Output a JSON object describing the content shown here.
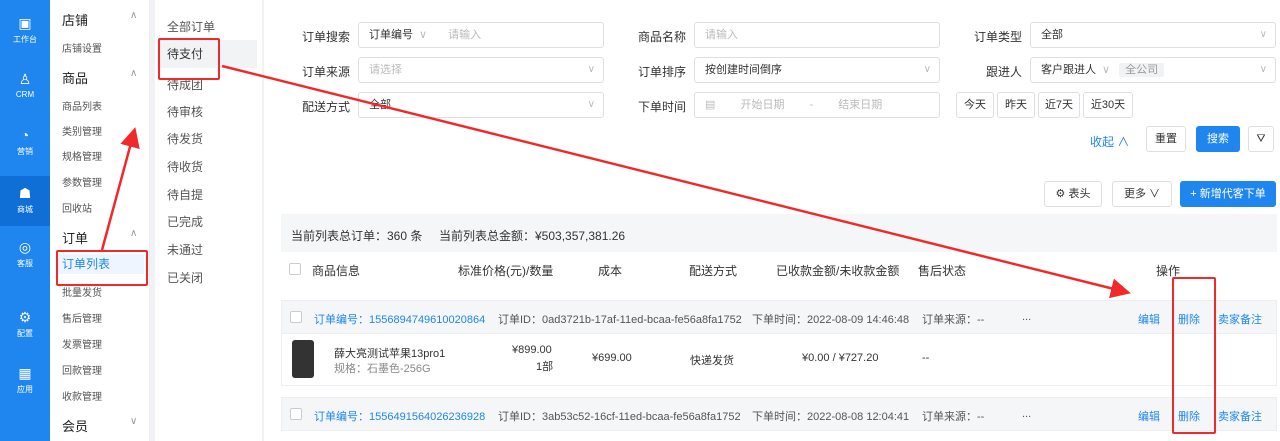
{
  "rail": [
    {
      "label": "工作台",
      "icon": "workbench-icon",
      "glyph": "▣"
    },
    {
      "label": "CRM",
      "icon": "user-icon",
      "glyph": "♙"
    },
    {
      "label": "营销",
      "icon": "marketing-icon",
      "glyph": "◔"
    },
    {
      "label": "商城",
      "icon": "shop-icon",
      "glyph": "☗"
    },
    {
      "label": "客服",
      "icon": "chat-icon",
      "glyph": "◎"
    },
    {
      "label": "配置",
      "icon": "gear-icon",
      "glyph": "⚙"
    },
    {
      "label": "应用",
      "icon": "apps-icon",
      "glyph": "▦"
    }
  ],
  "menu": {
    "groups": [
      "店铺",
      "商品",
      "订单",
      "会员"
    ],
    "items": [
      "店铺设置",
      "商品列表",
      "类别管理",
      "规格管理",
      "参数管理",
      "回收站",
      "订单列表",
      "批量发货",
      "售后管理",
      "发票管理",
      "回款管理",
      "收款管理"
    ]
  },
  "status_tabs": [
    "全部订单",
    "待支付",
    "待成团",
    "待审核",
    "待发货",
    "待收货",
    "待自提",
    "已完成",
    "未通过",
    "已关闭"
  ],
  "filters": {
    "search_label": "订单搜索",
    "search_type": "订单编号",
    "search_ph": "请输入",
    "goods_label": "商品名称",
    "goods_ph": "请输入",
    "type_label": "订单类型",
    "type_val": "全部",
    "source_label": "订单来源",
    "source_ph": "请选择",
    "sort_label": "订单排序",
    "sort_val": "按创建时间倒序",
    "follow_label": "跟进人",
    "follow_val": "客户跟进人",
    "company": "全公司",
    "ship_label": "配送方式",
    "ship_val": "全部",
    "time_label": "下单时间",
    "start_ph": "开始日期",
    "dash": "-",
    "end_ph": "结束日期",
    "quick": [
      "今天",
      "昨天",
      "近7天",
      "近30天"
    ],
    "collapse": "收起 ∧",
    "reset": "重置",
    "search_btn": "搜索"
  },
  "toolbar": {
    "header_btn": "表头",
    "more_btn": "更多",
    "add_btn": "+ 新增代客下单"
  },
  "summary": {
    "total": "当前列表总订单：360 条",
    "amount": "当前列表总金额：¥503,357,381.26"
  },
  "columns": [
    "商品信息",
    "标准价格(元)/数量",
    "成本",
    "配送方式",
    "已收款金额/未收款金额",
    "售后状态",
    "操作"
  ],
  "orders": [
    {
      "no": "订单编号：1556894749610020864",
      "id": "订单ID：0ad3721b-17af-11ed-bcaa-fe56a8fa1752",
      "time": "下单时间：2022-08-09 14:46:48",
      "source": "订单来源：--",
      "dots": "...",
      "actions": [
        "编辑",
        "删除",
        "卖家备注"
      ],
      "product": "薛大亮测试苹果13pro1",
      "spec": "规格：石墨色-256G",
      "price": "¥899.00",
      "qty": "1部",
      "cost": "¥699.00",
      "ship": "快递发货",
      "paid": "¥0.00 / ¥727.20",
      "after": "--"
    },
    {
      "no": "订单编号：1556491564026236928",
      "id": "订单ID：3ab53c52-16cf-11ed-bcaa-fe56a8fa1752",
      "time": "下单时间：2022-08-08 12:04:41",
      "source": "订单来源：--",
      "dots": "...",
      "actions": [
        "编辑",
        "删除",
        "卖家备注"
      ]
    }
  ],
  "colors": {
    "primary": "#1f86f0",
    "annotation": "#f02a2a"
  }
}
